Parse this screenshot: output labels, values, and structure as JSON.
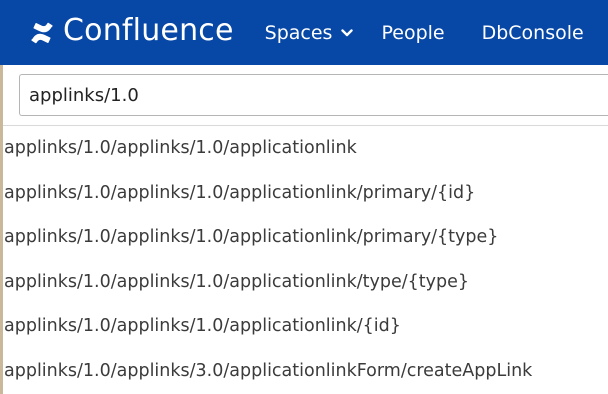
{
  "header": {
    "logo_icon": "confluence-x-icon",
    "brand": "Confluence",
    "nav": {
      "spaces": "Spaces",
      "people": "People",
      "dbconsole": "DbConsole"
    },
    "colors": {
      "background": "#0747a6",
      "text": "#ffffff"
    }
  },
  "search": {
    "value": "applinks/1.0"
  },
  "results": [
    "applinks/1.0/applinks/1.0/applicationlink",
    "applinks/1.0/applinks/1.0/applicationlink/primary/{id}",
    "applinks/1.0/applinks/1.0/applicationlink/primary/{type}",
    "applinks/1.0/applinks/1.0/applicationlink/type/{type}",
    "applinks/1.0/applinks/1.0/applicationlink/{id}",
    "applinks/1.0/applinks/3.0/applicationlinkForm/createAppLink"
  ]
}
